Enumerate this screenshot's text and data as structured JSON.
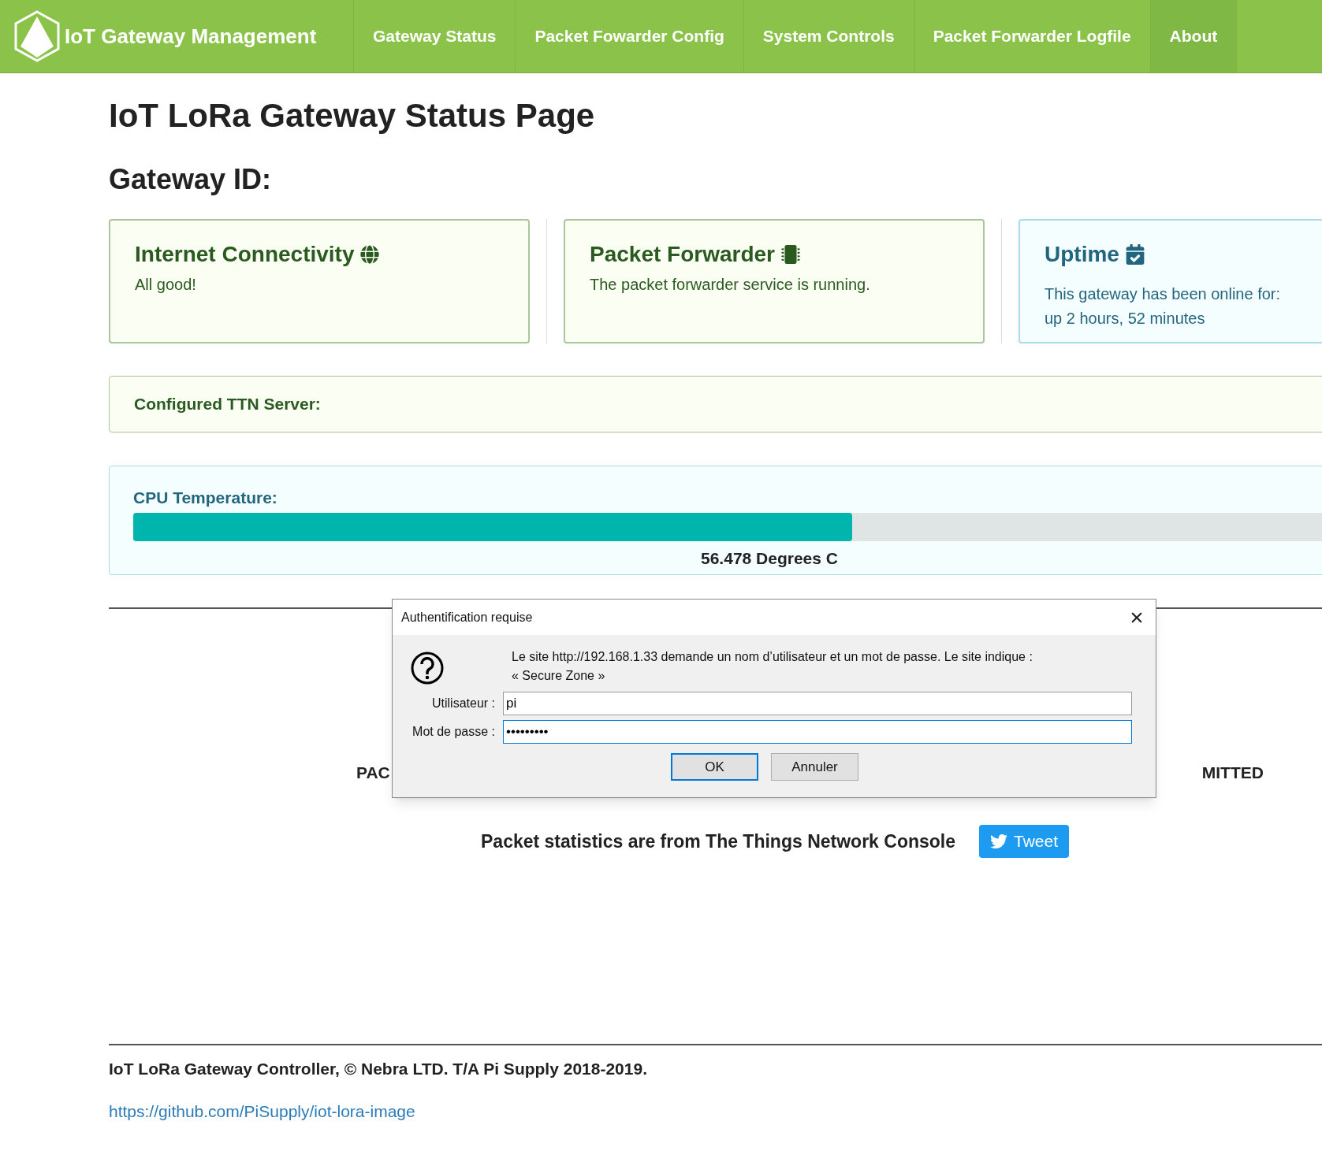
{
  "navbar": {
    "brand": "IoT Gateway Management",
    "items": [
      {
        "label": "Gateway Status",
        "selected": false
      },
      {
        "label": "Packet Fowarder Config",
        "selected": false
      },
      {
        "label": "System Controls",
        "selected": false
      },
      {
        "label": "Packet Forwarder Logfile",
        "selected": false
      },
      {
        "label": "About",
        "selected": true
      }
    ]
  },
  "page_title": "IoT LoRa Gateway Status Page",
  "gateway_id_label": "Gateway ID:",
  "cards": [
    {
      "kind": "success",
      "title": "Internet Connectivity",
      "lines": [
        "All good!"
      ]
    },
    {
      "kind": "success",
      "title": "Packet Forwarder",
      "lines": [
        "The packet forwarder service is running."
      ]
    },
    {
      "kind": "info",
      "title": "Uptime",
      "lines": [
        "This gateway has been online for:",
        "up 2 hours, 52 minutes"
      ]
    }
  ],
  "ttn_server": {
    "label": "Configured TTN Server:"
  },
  "cpu_temperature": {
    "label": "CPU Temperature:",
    "level": 0.565,
    "reading": "56.478 Degrees C"
  },
  "stats_partial": {
    "left_label": "PAC",
    "right_label": "MITTED"
  },
  "stats_note": "Packet statistics are from The Things Network Console",
  "tweet_button": "Tweet",
  "footer": {
    "text": "IoT LoRa Gateway Controller, © Nebra LTD. T/A Pi Supply 2018-2019.",
    "link": "https://github.com/PiSupply/iot-lora-image"
  },
  "dialog": {
    "title": "Authentification requise",
    "message": "Le site http://192.168.1.33 demande un nom d’utilisateur et un mot de passe. Le site indique :",
    "realm": "« Secure Zone »",
    "user_label": "Utilisateur :",
    "user_value": "pi",
    "password_label": "Mot de passe :",
    "password_value": "•••••••••",
    "ok": "OK",
    "cancel": "Annuler"
  }
}
